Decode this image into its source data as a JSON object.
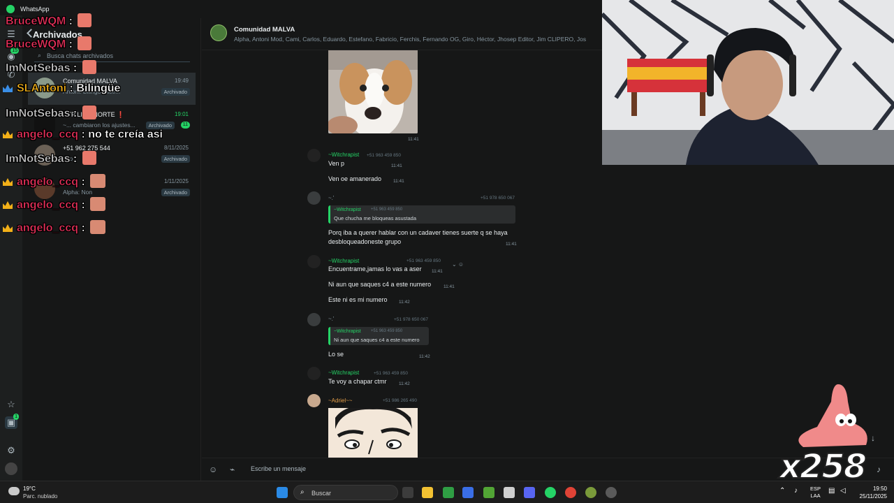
{
  "window": {
    "title": "WhatsApp"
  },
  "archived": {
    "title": "Archivados",
    "search_placeholder": "Busca chats archivados",
    "chats": [
      {
        "name": "Comunidad MALVA",
        "time": "19:49",
        "last": "Antoni: Bilingüe ace...",
        "badge": "Archivado"
      },
      {
        "name": "UTP LIMA NORTE ❗",
        "time": "19:01",
        "last": "~... cambiaron los ajustes...",
        "badge": "Archivado",
        "count": "11"
      },
      {
        "name": "+51 962 275 544",
        "time": "8/11/2025",
        "last": "foto",
        "badge": "Archivado"
      },
      {
        "name": "",
        "time": "1/11/2025",
        "last": "Alpha: Non",
        "badge": "Archivado"
      }
    ]
  },
  "rail": {
    "badge": "15",
    "bottom_badge": "1"
  },
  "chat_header": {
    "name": "Comunidad MALVA",
    "members": "Alpha, Antoni Mod, Cami, Carlos, Eduardo, Estefano, Fabricio, Ferchis, Fernando OG, Giro, Héctor, Jhosep Editor, Jim CLIPERO, Jos"
  },
  "messages": {
    "img1_time": "11:41",
    "m1": {
      "sender": "~Witchrapist",
      "phone": "+51 963 459 850",
      "text": "Ven p",
      "time": "11:41"
    },
    "m2": {
      "text": "Ven oe amanerado",
      "time": "11:41"
    },
    "m3": {
      "sender": "~.'",
      "phone": "+51 978 650 067",
      "quote_sender": "~Witchrapist",
      "quote_phone": "+51 963 459 850",
      "quote_text": "Que chucha me bloqueas asustada",
      "text_line1": "Porq iba a querer hablar con un cadaver tienes suerte q se haya",
      "text_line2": "desbloqueadoneste grupo",
      "time": "11:41"
    },
    "m4": {
      "sender": "~Witchrapist",
      "phone": "+51 963 459 850",
      "text": "Encuentrame,jamas lo vas a aser",
      "time": "11:41"
    },
    "m5": {
      "text": "Ni aun que saques c4 a este numero",
      "time": "11:41"
    },
    "m6": {
      "text": "Este ni es mi numero",
      "time": "11:42"
    },
    "m7": {
      "sender": "~.'",
      "phone": "+51 978 650 067",
      "quote_sender": "~Witchrapist",
      "quote_phone": "+51 963 459 850",
      "quote_text": "Ni aun que saques c4 a este numero",
      "text": "Lo se",
      "time": "11:42"
    },
    "m8": {
      "sender": "~Witchrapist",
      "phone": "+51 963 459 850",
      "text": "Te voy a chapar ctmr",
      "time": "11:42"
    },
    "m9": {
      "sender": "~Adriel~~",
      "phone": "+51 986 265 490"
    }
  },
  "composer": {
    "placeholder": "Escribe un mensaje"
  },
  "stream_chat": [
    {
      "user": "BruceWQM",
      "text": "",
      "color": "#e8305a"
    },
    {
      "user": "BruceWQM",
      "text": "",
      "color": "#e8305a"
    },
    {
      "user": "ImNotSebas",
      "text": "",
      "color": "#c9c9c9"
    },
    {
      "user": "SLAntoni",
      "text": "Bilingüe",
      "color": "#f2b018"
    },
    {
      "user": "ImNotSebas",
      "text": "",
      "color": "#c9c9c9"
    },
    {
      "user": "angelo_ccq",
      "text": "no te creía asi",
      "color": "#e8305a"
    },
    {
      "user": "ImNotSebas",
      "text": "",
      "color": "#c9c9c9"
    },
    {
      "user": "angelo_ccq",
      "text": "",
      "color": "#e8305a"
    },
    {
      "user": "angelo_ccq",
      "text": "",
      "color": "#e8305a"
    },
    {
      "user": "angelo_ccq",
      "text": "",
      "color": "#e8305a"
    }
  ],
  "combo": "x258",
  "taskbar": {
    "temp": "19°C",
    "weather": "Parc. nublado",
    "search": "Buscar",
    "lang1": "ESP",
    "lang2": "LAA",
    "time": "19:50",
    "date": "25/11/2025"
  }
}
